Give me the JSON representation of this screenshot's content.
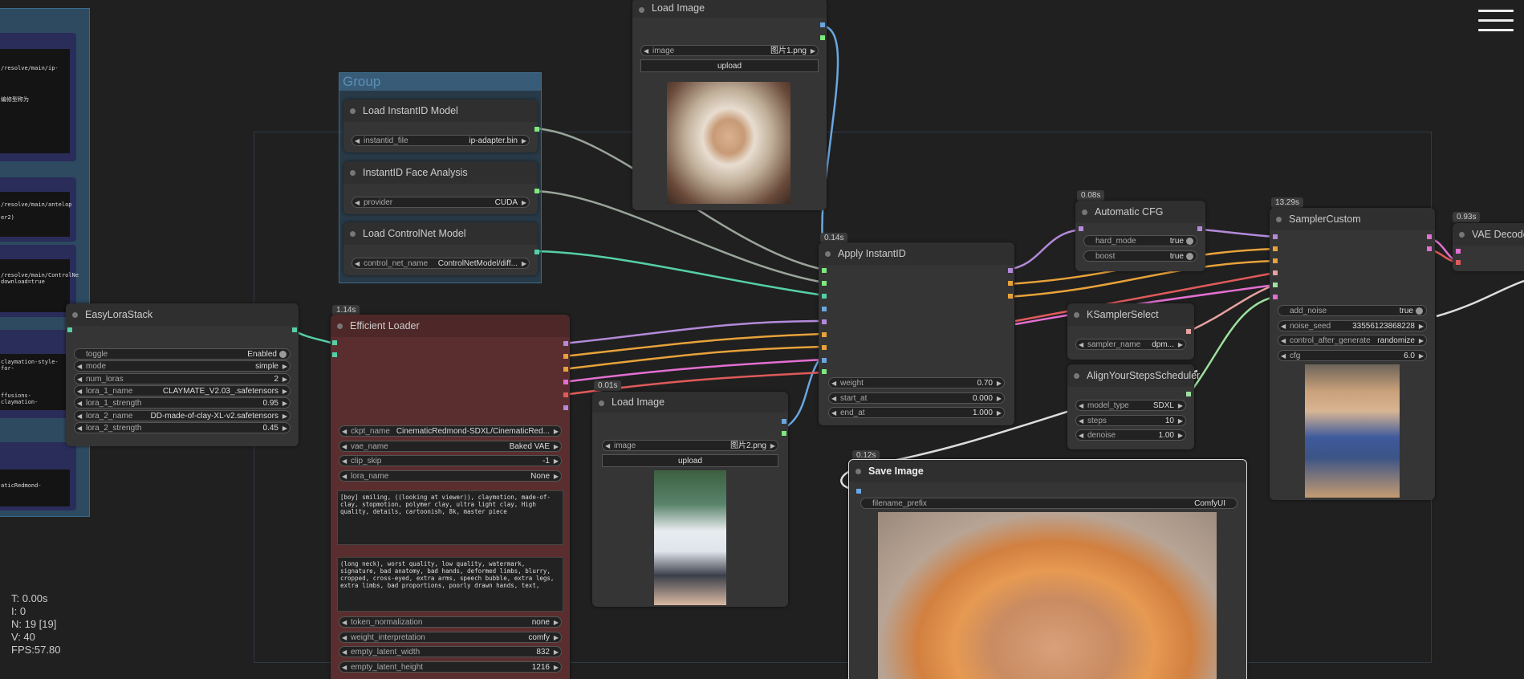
{
  "menu_icon": "hamburger-icon",
  "stats": {
    "t": "T: 0.00s",
    "i": "I: 0",
    "n": "N: 19 [19]",
    "v": "V: 40",
    "fps": "FPS:57.80"
  },
  "left_panel": {
    "lines": [
      "/resolve/main/ip-",
      "编修型称为",
      "/resolve/main/antelop",
      "er2)",
      "/resolve/main/ControlNe",
      "download=true",
      "claymation-style-for-",
      "ffusions-claymation-",
      "aticRedmond-"
    ]
  },
  "group": {
    "title": "Group"
  },
  "load_instantid_model": {
    "title": "Load InstantID Model",
    "w_label": "instantid_file",
    "w_value": "ip-adapter.bin"
  },
  "face_analysis": {
    "title": "InstantID Face Analysis",
    "w_label": "provider",
    "w_value": "CUDA"
  },
  "controlnet": {
    "title": "Load ControlNet Model",
    "w_label": "control_net_name",
    "w_value": "ControlNetModel/diff..."
  },
  "load_image_1": {
    "title": "Load Image",
    "image_label": "image",
    "image_value": "图片1.png",
    "upload": "upload"
  },
  "load_image_2": {
    "timing": "0.01s",
    "title": "Load Image",
    "image_label": "image",
    "image_value": "图片2.png",
    "upload": "upload"
  },
  "easy_lora": {
    "title": "EasyLoraStack",
    "widgets": [
      {
        "label": "toggle",
        "value": "Enabled"
      },
      {
        "label": "mode",
        "value": "simple"
      },
      {
        "label": "num_loras",
        "value": "2"
      },
      {
        "label": "lora_1_name",
        "value": "CLAYMATE_V2.03_.safetensors"
      },
      {
        "label": "lora_1_strength",
        "value": "0.95"
      },
      {
        "label": "lora_2_name",
        "value": "DD-made-of-clay-XL-v2.safetensors"
      },
      {
        "label": "lora_2_strength",
        "value": "0.45"
      }
    ]
  },
  "efficient_loader": {
    "timing": "1.14s",
    "title": "Efficient Loader",
    "widgets_top": [
      {
        "label": "ckpt_name",
        "value": "CinematicRedmond-SDXL/CinematicRed..."
      },
      {
        "label": "vae_name",
        "value": "Baked VAE"
      },
      {
        "label": "clip_skip",
        "value": "-1"
      },
      {
        "label": "lora_name",
        "value": "None"
      }
    ],
    "positive": "[boy] smiling, ((looking at viewer)), claymotion, made-of-clay, stopmotion, polymer clay, ultra light clay, High quality, details, cartoonish, 8k, master piece",
    "negative": "(long neck), worst quality, low quality, watermark, signature, bad anatomy, bad hands, deformed limbs, blurry, cropped, cross-eyed, extra arms, speech bubble, extra legs, extra limbs, bad proportions, poorly drawn hands, text,",
    "widgets_bottom": [
      {
        "label": "token_normalization",
        "value": "none"
      },
      {
        "label": "weight_interpretation",
        "value": "comfy"
      },
      {
        "label": "empty_latent_width",
        "value": "832"
      },
      {
        "label": "empty_latent_height",
        "value": "1216"
      }
    ]
  },
  "apply_instantid": {
    "timing": "0.14s",
    "title": "Apply InstantID",
    "widgets": [
      {
        "label": "weight",
        "value": "0.70"
      },
      {
        "label": "start_at",
        "value": "0.000"
      },
      {
        "label": "end_at",
        "value": "1.000"
      }
    ]
  },
  "auto_cfg": {
    "timing": "0.08s",
    "title": "Automatic CFG",
    "widgets": [
      {
        "label": "hard_mode",
        "value": "true"
      },
      {
        "label": "boost",
        "value": "true"
      }
    ]
  },
  "ksampler_select": {
    "title": "KSamplerSelect",
    "w_label": "sampler_name",
    "w_value": "dpm..."
  },
  "ays": {
    "title": "AlignYourStepsScheduler",
    "widgets": [
      {
        "label": "model_type",
        "value": "SDXL"
      },
      {
        "label": "steps",
        "value": "10"
      },
      {
        "label": "denoise",
        "value": "1.00"
      }
    ]
  },
  "sampler_custom": {
    "timing": "13.29s",
    "title": "SamplerCustom",
    "widgets": [
      {
        "label": "add_noise",
        "value": "true"
      },
      {
        "label": "noise_seed",
        "value": "33556123868228"
      },
      {
        "label": "control_after_generate",
        "value": "randomize"
      },
      {
        "label": "cfg",
        "value": "6.0"
      }
    ]
  },
  "vae_decode": {
    "timing": "0.93s",
    "title": "VAE Decode"
  },
  "save_image": {
    "timing": "0.12s",
    "title": "Save Image",
    "w_label": "filename_prefix",
    "w_value": "ComfyUI"
  },
  "colors": {
    "purple": "#b38ad9",
    "orange": "#e8a23a",
    "green": "#6dd38c",
    "pink": "#e36fd1",
    "red": "#e05a5a",
    "blue": "#6aa7e0",
    "teal": "#56cfa6",
    "node_bg": "#353535",
    "efficient_bg": "#5a2e2e"
  }
}
